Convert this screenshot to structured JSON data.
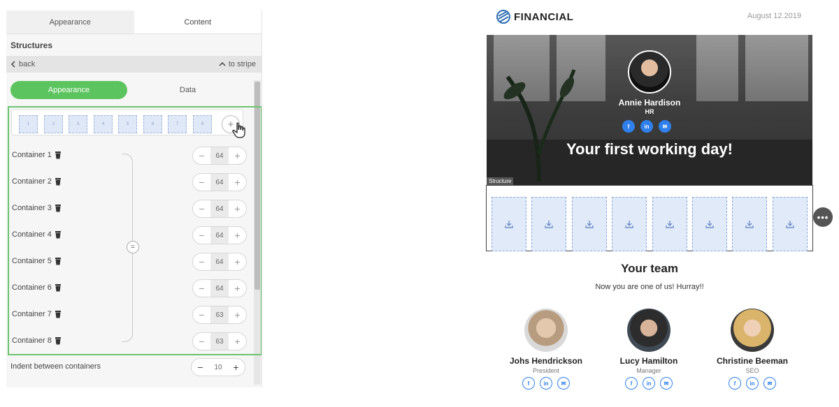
{
  "panel": {
    "tabs": [
      {
        "label": "Appearance",
        "active": false
      },
      {
        "label": "Content",
        "active": true
      }
    ],
    "section_title": "Structures",
    "back_label": "back",
    "to_stripe_label": "to stripe",
    "toggle": {
      "active": "Appearance",
      "other": "Data"
    },
    "grid_cells": [
      "1",
      "2",
      "3",
      "4",
      "5",
      "6",
      "7",
      "8"
    ],
    "containers": [
      {
        "label": "Container 1",
        "value": "64"
      },
      {
        "label": "Container 2",
        "value": "64"
      },
      {
        "label": "Container 3",
        "value": "64"
      },
      {
        "label": "Container 4",
        "value": "64"
      },
      {
        "label": "Container 5",
        "value": "64"
      },
      {
        "label": "Container 6",
        "value": "64"
      },
      {
        "label": "Container 7",
        "value": "63"
      },
      {
        "label": "Container 8",
        "value": "63"
      }
    ],
    "indent": {
      "label": "Indent between containers",
      "value": "10"
    }
  },
  "email": {
    "logo_text": "FINANCIAL",
    "date": "August 12.2019",
    "hero": {
      "name": "Annie Hardison",
      "role": "HR",
      "title": "Your first working day!",
      "socials": [
        "f",
        "in",
        "✉"
      ]
    },
    "structure_label": "Structure",
    "drop_count": 8,
    "team": {
      "title": "Your team",
      "subtitle": "Now you are one of us! Hurray!!",
      "members": [
        {
          "name": "Johs Hendrickson",
          "role": "President"
        },
        {
          "name": "Lucy Hamilton",
          "role": "Manager"
        },
        {
          "name": "Christine Beeman",
          "role": "SEO"
        }
      ]
    }
  },
  "colors": {
    "accent": "#5cc45f",
    "link": "#2f80ed"
  }
}
